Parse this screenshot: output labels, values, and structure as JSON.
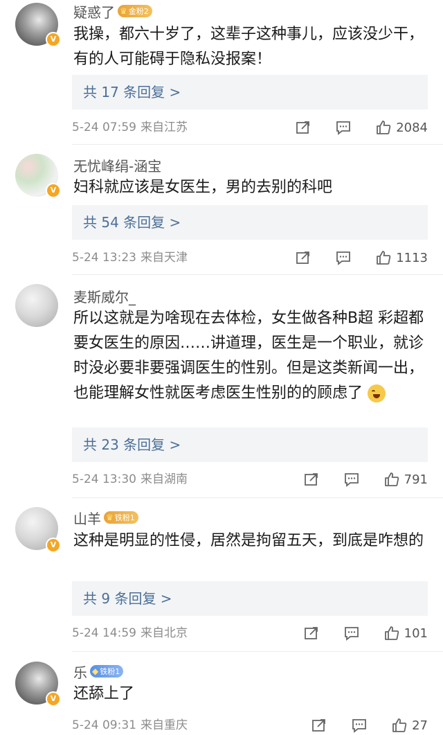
{
  "comments": [
    {
      "username": "疑惑了",
      "badge": {
        "text": "金粉2",
        "style": "gold"
      },
      "text": "我操，都六十岁了，这辈子这种事儿，应该没少干，有的人可能碍于隐私没报案！",
      "replies": "共 17 条回复 >",
      "date": "5-24 07:59",
      "location": "来自江苏",
      "likes": "2084"
    },
    {
      "username": "无忧峰绢-涵宝",
      "badge": null,
      "text": "妇科就应该是女医生，男的去别的科吧",
      "replies": "共 54 条回复 >",
      "date": "5-24 13:23",
      "location": "来自天津",
      "likes": "1113"
    },
    {
      "username": "麦斯威尔_",
      "badge": null,
      "text": "所以这就是为啥现在去体检，女生做各种B超 彩超都要女医生的原因……讲道理，医生是一个职业，就诊时没必要非要强调医生的性别。但是这类新闻一出，也能理解女性就医考虑医生性别的的顾虑了",
      "replies": "共 23 条回复 >",
      "date": "5-24 13:30",
      "location": "来自湖南",
      "likes": "791"
    },
    {
      "username": "山羊",
      "badge": {
        "text": "铁粉1",
        "style": "gold"
      },
      "text": "这种是明显的性侵，居然是拘留五天，到底是咋想的",
      "replies": "共 9 条回复 >",
      "date": "5-24 14:59",
      "location": "来自北京",
      "likes": "101"
    },
    {
      "username": "乐",
      "badge": {
        "text": "铁粉1",
        "style": "iron"
      },
      "text": "还舔上了",
      "replies": "",
      "date": "5-24 09:31",
      "location": "来自重庆",
      "likes": "27"
    }
  ],
  "icons": {
    "repost": "repost-icon",
    "comment": "comment-icon",
    "like": "like-icon",
    "verified": "verified-v-icon",
    "emoji": "laughing-crying-emoji-icon"
  },
  "colors": {
    "reply_link": "#4b6f98",
    "reply_bg": "#f3f4f6",
    "verified": "#f5a623"
  }
}
